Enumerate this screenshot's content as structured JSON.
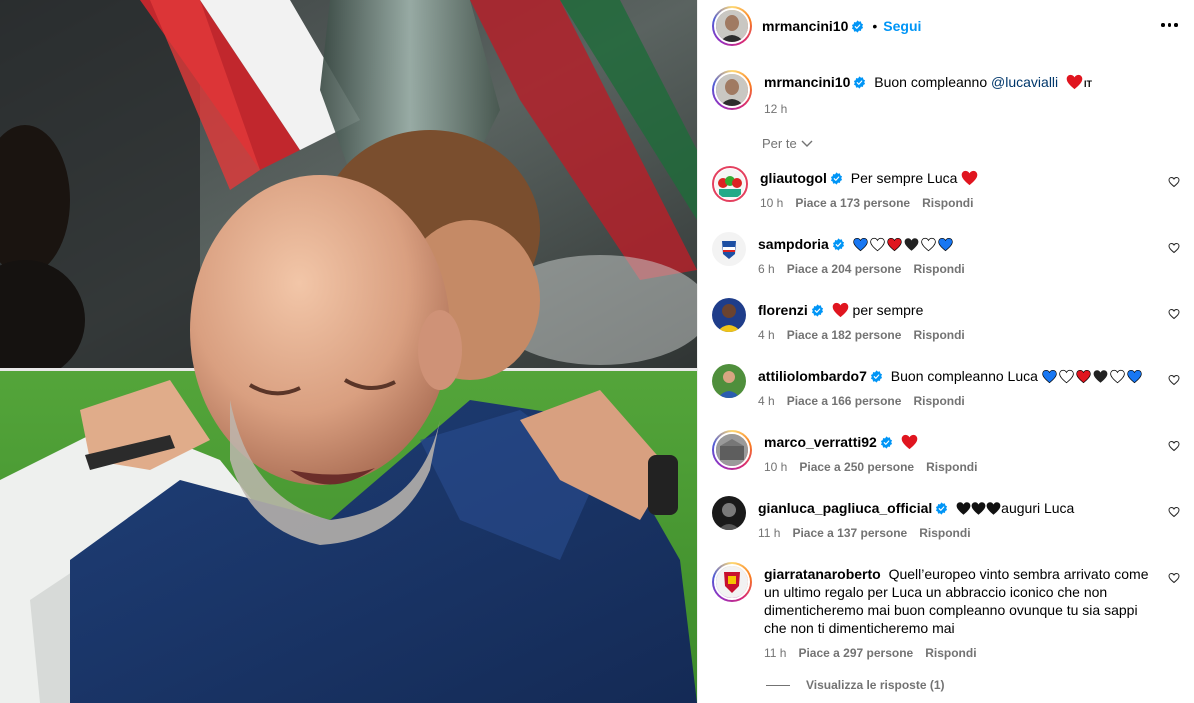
{
  "post": {
    "author": "mrmancini10",
    "follow_label": "Segui",
    "dot": "•",
    "caption_text": "Buon compleanno ",
    "caption_mention": "@lucavialli",
    "caption_flag": "IT",
    "caption_time": "12 h"
  },
  "sort_label": "Per te",
  "comments": [
    {
      "user": "gliautogol",
      "text": "Per sempre Luca ",
      "time": "10 h",
      "likes": "Piace a 173 persone",
      "reply": "Rispondi"
    },
    {
      "user": "sampdoria",
      "text": "",
      "time": "6 h",
      "likes": "Piace a 204 persone",
      "reply": "Rispondi"
    },
    {
      "user": "florenzi",
      "text": " per sempre",
      "time": "4 h",
      "likes": "Piace a 182 persone",
      "reply": "Rispondi"
    },
    {
      "user": "attiliolombardo7",
      "text": "Buon compleanno Luca ",
      "time": "4 h",
      "likes": "Piace a 166 persone",
      "reply": "Rispondi"
    },
    {
      "user": "marco_verratti92",
      "text": "",
      "time": "10 h",
      "likes": "Piace a 250 persone",
      "reply": "Rispondi"
    },
    {
      "user": "gianluca_pagliuca_official",
      "text": "auguri Luca",
      "time": "11 h",
      "likes": "Piace a 137 persone",
      "reply": "Rispondi"
    },
    {
      "user": "giarratanaroberto",
      "text": "Quell’europeo vinto sembra arrivato come un ultimo regalo per Luca un abbraccio iconico che non dimenticheremo mai buon compleanno ovunque tu sia sappi che non ti dimenticheremo mai",
      "time": "11 h",
      "likes": "Piace a 297 persone",
      "reply": "Rispondi"
    }
  ],
  "view_replies": "Visualizza le risposte (1)",
  "colors": {
    "accent": "#0095f6",
    "muted": "#737373",
    "verified": "#0095f6",
    "heart_red": "#e0151f",
    "heart_blue": "#1877f2"
  },
  "icons": [
    "more-options-icon",
    "verified-badge-icon",
    "chevron-down-icon",
    "like-heart-icon"
  ]
}
